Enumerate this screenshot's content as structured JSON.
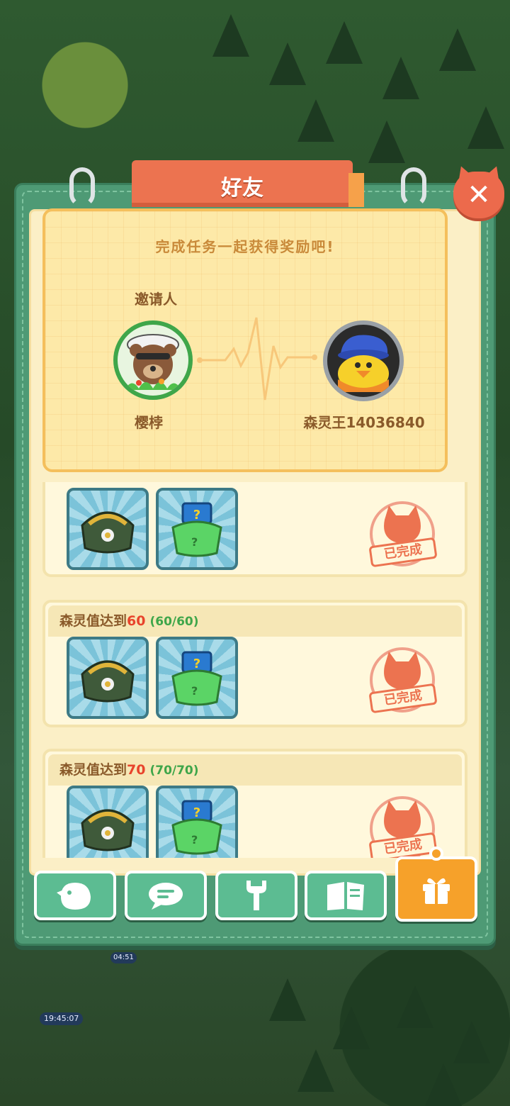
{
  "header": {
    "title": "好友"
  },
  "invite": {
    "heading": "完成任务一起获得奖励吧!",
    "inviter_label": "邀请人",
    "inviter_name": "樱桲",
    "friend_name": "森灵王14036840"
  },
  "tasks": [
    {
      "title": "",
      "target": "",
      "progress": "",
      "status": "已完成"
    },
    {
      "title": "森灵值达到",
      "target": "60",
      "progress": "(60/60)",
      "status": "已完成"
    },
    {
      "title": "森灵值达到",
      "target": "70",
      "progress": "(70/70)",
      "status": "已完成"
    }
  ],
  "rewards": [
    "coin-purse-icon",
    "mystery-bag-icon"
  ],
  "bottom_nav": [
    {
      "icon": "chick-icon"
    },
    {
      "icon": "chat-icon"
    },
    {
      "icon": "wrench-icon"
    },
    {
      "icon": "book-icon"
    },
    {
      "icon": "gift-icon",
      "active": true
    }
  ],
  "background": {
    "timer": "19:45:07",
    "small_timer": "04:51"
  },
  "colors": {
    "accent": "#ec7350",
    "panel": "#4e9a75",
    "done": "#ec7350",
    "progress": "#3fa64a",
    "target": "#e8442c"
  }
}
